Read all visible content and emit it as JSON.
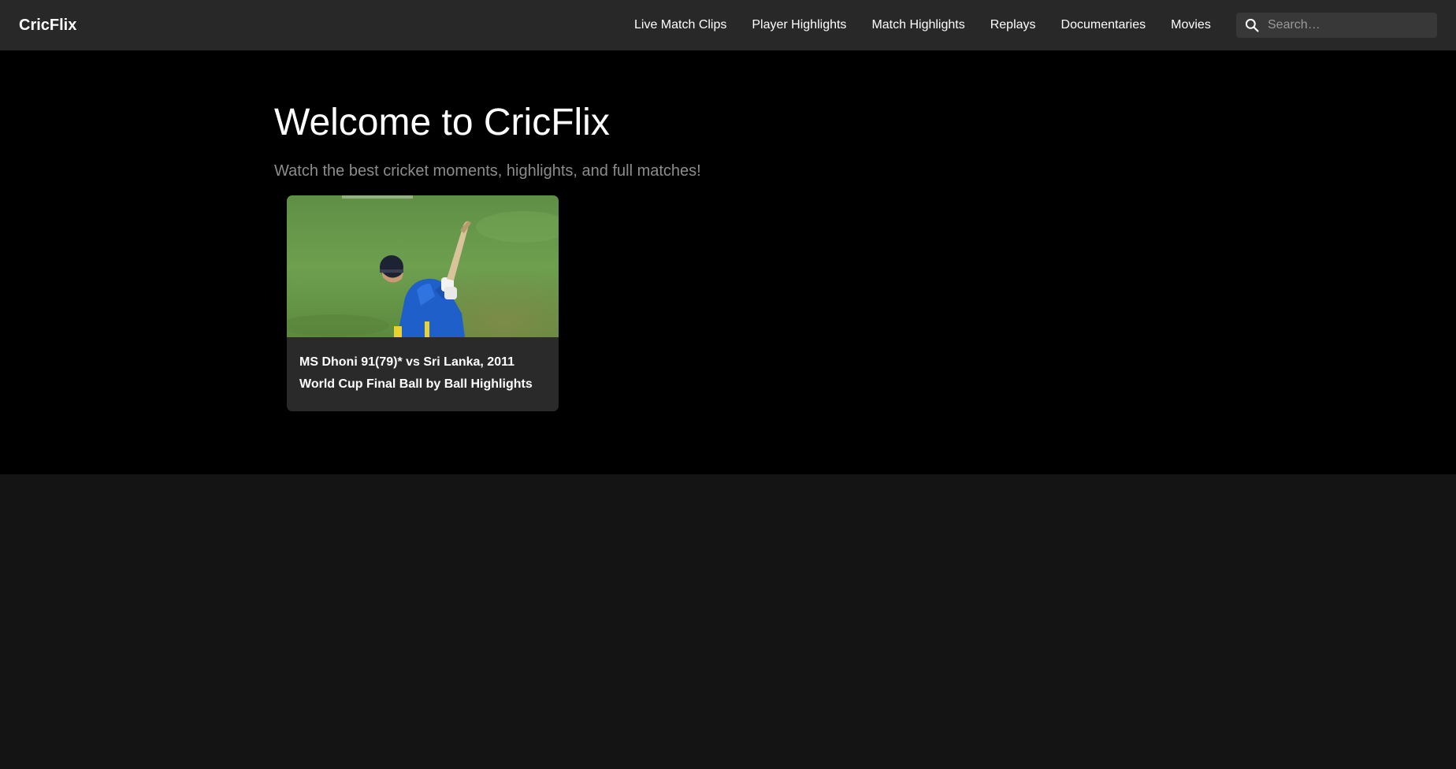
{
  "header": {
    "brand": "CricFlix",
    "nav": [
      {
        "label": "Live Match Clips"
      },
      {
        "label": "Player Highlights"
      },
      {
        "label": "Match Highlights"
      },
      {
        "label": "Replays"
      },
      {
        "label": "Documentaries"
      },
      {
        "label": "Movies"
      }
    ],
    "search": {
      "placeholder": "Search…",
      "value": "",
      "icon": "search-icon"
    }
  },
  "hero": {
    "title": "Welcome to CricFlix",
    "subtitle": "Watch the best cricket moments, highlights, and full matches!"
  },
  "videos": [
    {
      "title": "MS Dhoni 91(79)* vs Sri Lanka, 2011 World Cup Final Ball by Ball Highlights"
    }
  ],
  "colors": {
    "header_bg": "#282828",
    "hero_bg": "#000000",
    "page_bg": "#141414",
    "card_bg": "#2a2a2a",
    "subtitle_text": "#8c8c8c"
  }
}
